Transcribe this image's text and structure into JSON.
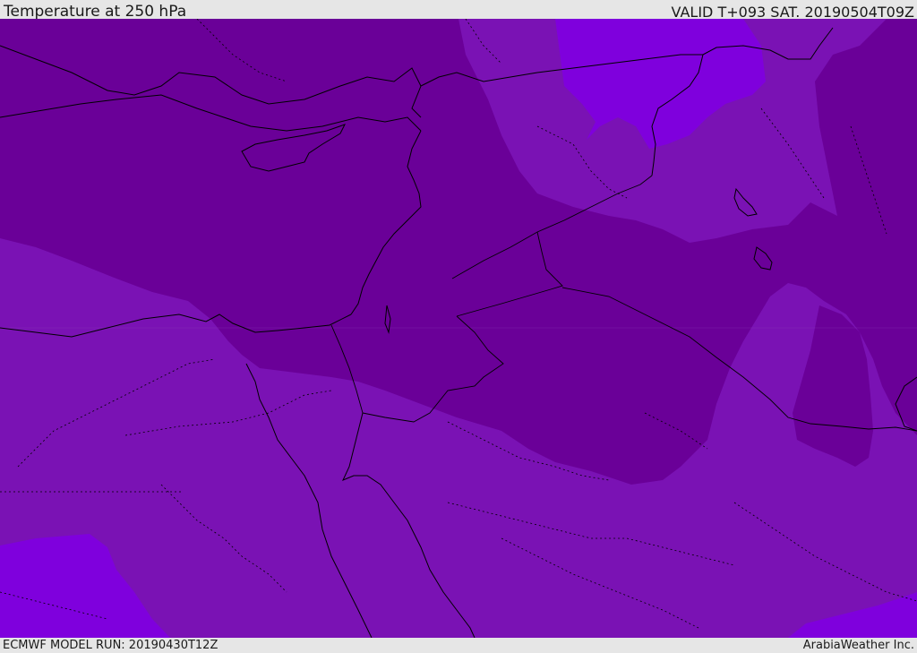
{
  "header": {
    "title": "Temperature at 250 hPa",
    "valid_time": "VALID T+093 SAT. 20190504T09Z"
  },
  "footer": {
    "model_run": "ECMWF MODEL RUN: 20190430T12Z",
    "credit": "ArabiaWeather Inc."
  },
  "map": {
    "field": "temperature",
    "level": "250 hPa",
    "colors": {
      "dark_purple": "#6a0098",
      "medium_purple": "#7a12b4",
      "violet": "#7f00dd",
      "coastline": "#000000",
      "border": "#000000"
    }
  }
}
